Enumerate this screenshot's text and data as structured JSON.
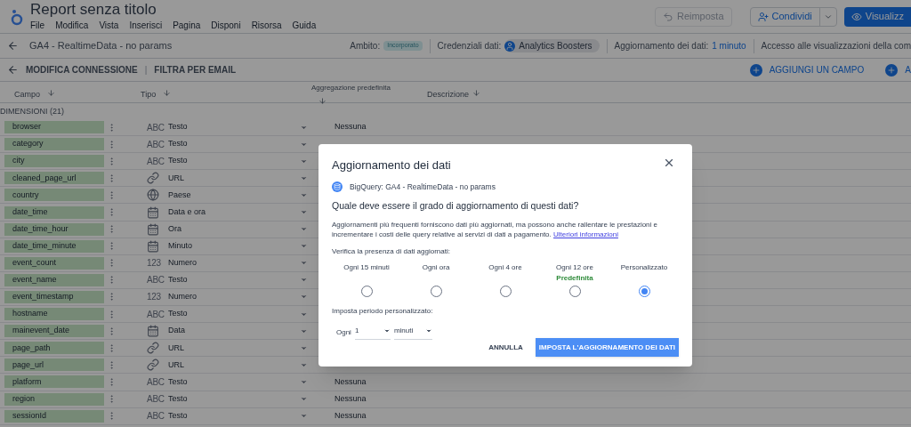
{
  "header": {
    "title": "Report senza titolo",
    "menu": [
      "File",
      "Modifica",
      "Vista",
      "Inserisci",
      "Pagina",
      "Disponi",
      "Risorsa",
      "Guida"
    ],
    "reset_button": {
      "label": "Reimposta",
      "disabled": true
    },
    "share_button": "Condividi",
    "view_button": "Visualizz"
  },
  "source_bar": {
    "name": "GA4 - RealtimeData - no params",
    "scope_label": "Ambito:",
    "scope_badge": "Incorporato",
    "credentials_label": "Credenziali dati:",
    "credentials_chip": "Analytics Boosters",
    "freshness_label": "Aggiornamento dei dati:",
    "freshness_link": "1 minuto",
    "access_label": "Accesso alle visualizzazioni della com"
  },
  "actions": {
    "edit_connection": "MODIFICA CONNESSIONE",
    "separator": "|",
    "filter": "FILTRA PER EMAIL",
    "add_field": "AGGIUNGI UN CAMPO",
    "add_other": "A"
  },
  "columns": [
    "Campo",
    "Tipo",
    "Aggregazione predefinita",
    "Descrizione"
  ],
  "section": "DIMENSIONI (21)",
  "rows": [
    {
      "name": "browser",
      "kind": "text",
      "type_glyph": "ABC",
      "type": "Testo",
      "aggregation": "Nessuna"
    },
    {
      "name": "category",
      "kind": "text",
      "type_glyph": "ABC",
      "type": "Testo"
    },
    {
      "name": "city",
      "kind": "text",
      "type_glyph": "ABC",
      "type": "Testo"
    },
    {
      "name": "cleaned_page_url",
      "kind": "url",
      "type": "URL"
    },
    {
      "name": "country",
      "kind": "geo",
      "type": "Paese"
    },
    {
      "name": "date_time",
      "kind": "date",
      "type": "Data e ora"
    },
    {
      "name": "date_time_hour",
      "kind": "date",
      "type": "Ora"
    },
    {
      "name": "date_time_minute",
      "kind": "date",
      "type": "Minuto"
    },
    {
      "name": "event_count",
      "kind": "number",
      "type_glyph": "123",
      "type": "Numero"
    },
    {
      "name": "event_name",
      "kind": "text",
      "type_glyph": "ABC",
      "type": "Testo"
    },
    {
      "name": "event_timestamp",
      "kind": "number",
      "type_glyph": "123",
      "type": "Numero"
    },
    {
      "name": "hostname",
      "kind": "text",
      "type_glyph": "ABC",
      "type": "Testo"
    },
    {
      "name": "mainevent_date",
      "kind": "date",
      "type": "Data"
    },
    {
      "name": "page_path",
      "kind": "url",
      "type": "URL"
    },
    {
      "name": "page_url",
      "kind": "url",
      "type": "URL"
    },
    {
      "name": "platform",
      "kind": "text",
      "type_glyph": "ABC",
      "type": "Testo",
      "aggregation": "Nessuna"
    },
    {
      "name": "region",
      "kind": "text",
      "type_glyph": "ABC",
      "type": "Testo",
      "aggregation": "Nessuna"
    },
    {
      "name": "sessionId",
      "kind": "text",
      "type_glyph": "ABC",
      "type": "Testo",
      "aggregation": "Nessuna"
    }
  ],
  "dialog": {
    "title": "Aggiornamento dei dati",
    "source": "BigQuery: GA4 - RealtimeData - no params",
    "question": "Quale deve essere il grado di aggiornamento di questi dati?",
    "description": "Aggiornamenti più frequenti forniscono dati più aggiornati, ma possono anche rallentare le prestazioni e incrementare i costi delle query relative ai servizi di dati a pagamento.",
    "learn_more": "Ulteriori informazioni",
    "check_label": "Verifica la presenza di dati aggiornati:",
    "options": [
      {
        "label": "Ogni 15 minuti",
        "selected": false
      },
      {
        "label": "Ogni ora",
        "selected": false
      },
      {
        "label": "Ogni 4 ore",
        "selected": false
      },
      {
        "label": "Ogni 12 ore",
        "note": "Predefinita",
        "selected": false
      },
      {
        "label": "Personalizzato",
        "selected": true
      }
    ],
    "custom_label": "Imposta periodo personalizzato:",
    "every": "Ogni",
    "amount": "1",
    "unit": "minuti",
    "cancel": "ANNULLA",
    "confirm": "IMPOSTA L'AGGIORNAMENTO DEI DATI"
  }
}
